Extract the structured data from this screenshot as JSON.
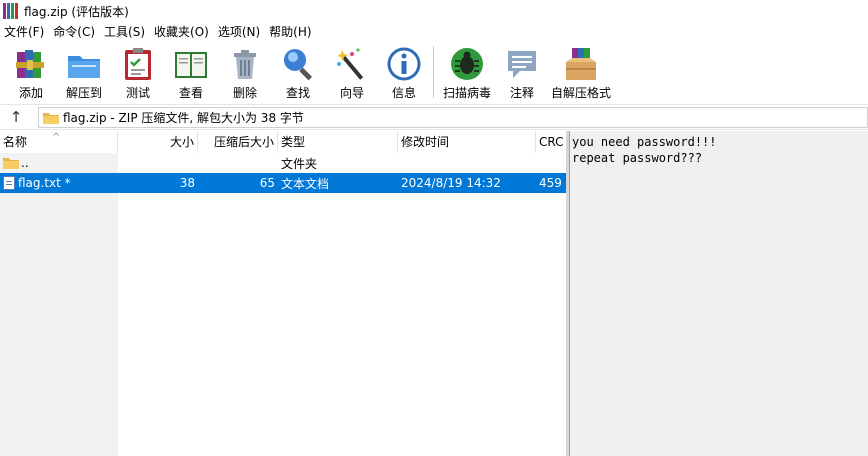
{
  "window": {
    "title": "flag.zip (评估版本)"
  },
  "menu": [
    "文件(F)",
    "命令(C)",
    "工具(S)",
    "收藏夹(O)",
    "选项(N)",
    "帮助(H)"
  ],
  "toolbar": {
    "buttons": [
      {
        "label": "添加",
        "icon": "add-books-icon"
      },
      {
        "label": "解压到",
        "icon": "extract-folder-icon"
      },
      {
        "label": "测试",
        "icon": "test-clipboard-icon"
      },
      {
        "label": "查看",
        "icon": "view-book-icon"
      },
      {
        "label": "删除",
        "icon": "trash-can-icon"
      },
      {
        "label": "查找",
        "icon": "magnifier-icon"
      },
      {
        "label": "向导",
        "icon": "wizard-wand-icon"
      },
      {
        "label": "信息",
        "icon": "info-icon"
      },
      {
        "label": "扫描病毒",
        "icon": "virus-scan-icon"
      },
      {
        "label": "注释",
        "icon": "comment-bubble-icon"
      },
      {
        "label": "自解压格式",
        "icon": "sfx-box-icon"
      }
    ]
  },
  "address": {
    "text": "flag.zip - ZIP 压缩文件, 解包大小为 38 字节"
  },
  "columns": {
    "name": "名称",
    "size": "大小",
    "packed": "压缩后大小",
    "type": "类型",
    "modified": "修改时间",
    "crc": "CRC"
  },
  "rows": [
    {
      "name": "..",
      "size": "",
      "packed": "",
      "type": "文件夹",
      "modified": "",
      "crc": ""
    },
    {
      "name": "flag.txt *",
      "size": "38",
      "packed": "65",
      "type": "文本文档",
      "modified": "2024/8/19 14:32",
      "crc": "459"
    }
  ],
  "comment": {
    "lines": [
      "you need password!!!",
      "repeat password???"
    ]
  },
  "colors": {
    "selection": "#0078d7",
    "comment_bg": "#f0f0f0"
  }
}
